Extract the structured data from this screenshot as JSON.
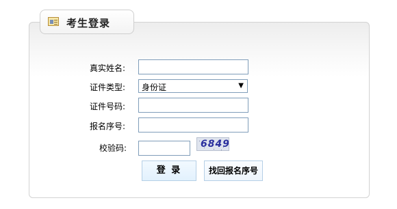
{
  "login_panel": {
    "title": "考生登录",
    "title_icon": "id-card-icon",
    "fields": {
      "name_label": "真实姓名:",
      "id_type_label": "证件类型:",
      "id_type_value": "身份证",
      "id_number_label": "证件号码:",
      "reg_number_label": "报名序号:",
      "captcha_label": "校验码:",
      "captcha_code": "6849"
    },
    "buttons": {
      "login": "登 录",
      "find_reg_number": "找回报名序号"
    }
  },
  "colors": {
    "input_border": "#7f9db9",
    "button_bg": "#e2f1fd",
    "captcha_text": "#2a2f9e"
  }
}
